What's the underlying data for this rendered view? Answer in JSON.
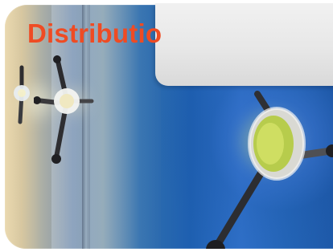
{
  "banner": {
    "title": "Distributio",
    "title_color": "#ef4b23",
    "background_icon": "vault-handle-icon"
  }
}
